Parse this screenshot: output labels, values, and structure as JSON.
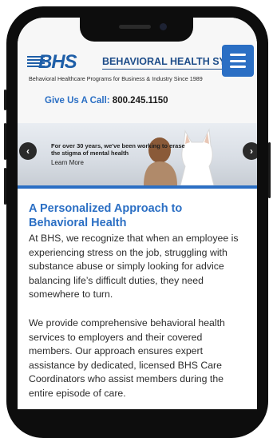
{
  "header": {
    "logo_text": "BHS",
    "brand_name": "BEHAVIORAL HEALTH SYS",
    "tagline": "Behavioral Healthcare Programs for Business & Industry Since 1989",
    "menu_icon": "hamburger-icon"
  },
  "call": {
    "label": "Give Us A Call:",
    "phone": "800.245.1150"
  },
  "hero": {
    "text": "For over 30 years, we've been working to erase the stigma of mental health",
    "link": "Learn More",
    "prev_icon": "chevron-left-icon",
    "next_icon": "chevron-right-icon"
  },
  "main": {
    "heading": "A Personalized Approach to Behavioral Health",
    "paragraphs": [
      "At BHS, we recognize that when an employee is experiencing stress on the job, struggling with substance abuse or simply looking for advice balancing life’s difficult duties, they need somewhere to turn.",
      "We provide comprehensive behavioral health services to employers and their covered members. Our approach ensures expert assistance by dedicated, licensed BHS Care Coordinators who assist members during the entire episode of care."
    ]
  },
  "colors": {
    "accent": "#2b6fc4",
    "brand": "#1f4e8a",
    "text": "#2c2c2c"
  }
}
